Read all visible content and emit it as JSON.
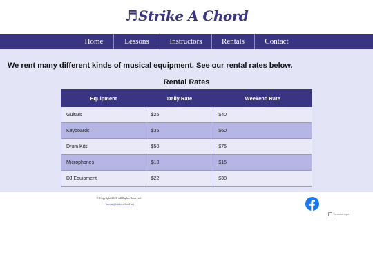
{
  "header": {
    "logo_icon": "♬",
    "logo_text": "Strike A Chord"
  },
  "nav": {
    "items": [
      {
        "label": "Home"
      },
      {
        "label": "Lessons"
      },
      {
        "label": "Instructors"
      },
      {
        "label": "Rentals"
      },
      {
        "label": "Contact"
      }
    ]
  },
  "main": {
    "intro": "We rent many different kinds of musical equipment. See our rental rates below.",
    "table_title": "Rental Rates",
    "columns": [
      "Equipment",
      "Daily Rate",
      "Weekend Rate"
    ],
    "rows": [
      [
        "Guitars",
        "$25",
        "$40"
      ],
      [
        "Keyboards",
        "$35",
        "$60"
      ],
      [
        "Drum Kits",
        "$50",
        "$75"
      ],
      [
        "Microphones",
        "$10",
        "$15"
      ],
      [
        "DJ Equipment",
        "$22",
        "$38"
      ]
    ]
  },
  "footer": {
    "copyright": "© Copyright 2023. All Rights Reserved.",
    "email": "lessons@strikeachord.net",
    "facebook_icon": "facebook-icon",
    "youtube_alt": "Youtube logo"
  },
  "colors": {
    "brand": "#3a3583",
    "background": "#e3e4f6",
    "row_light": "#e9e9f8",
    "row_dark": "#b5b6e3"
  }
}
